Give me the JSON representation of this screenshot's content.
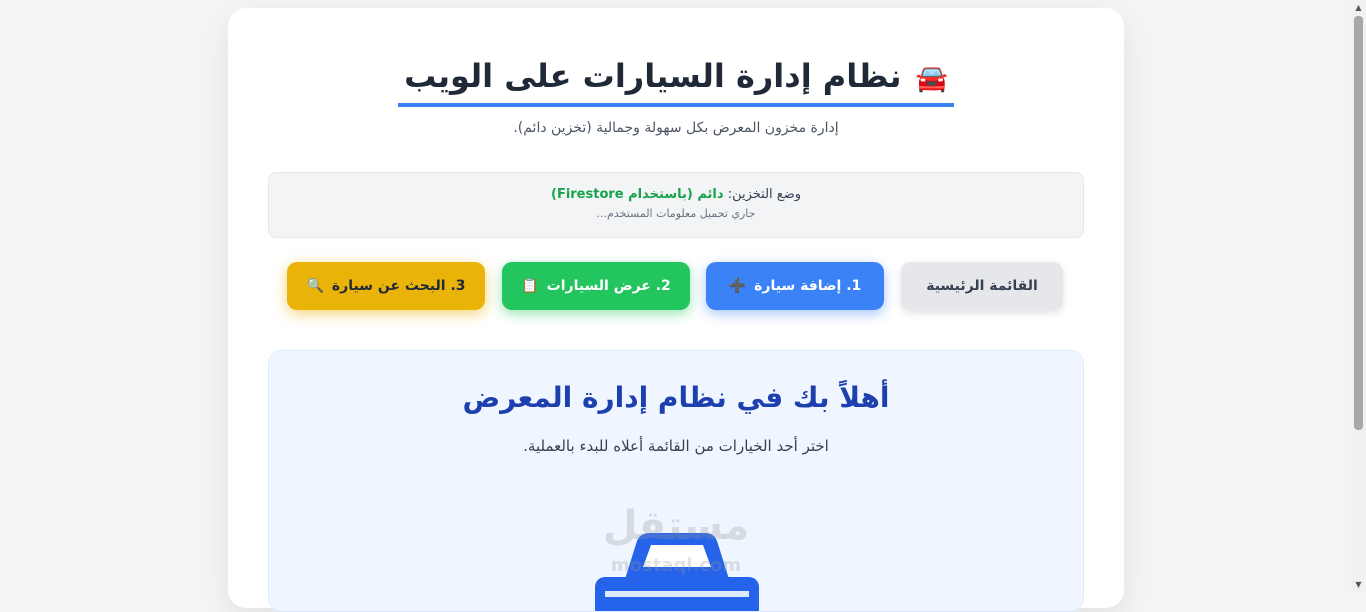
{
  "header": {
    "title": "نظام إدارة السيارات على الويب",
    "title_icon": "🚘",
    "subtitle": "إدارة مخزون المعرض بكل سهولة وجمالية (تخزين دائم)."
  },
  "storage": {
    "label": "وضع التخزين:",
    "mode": "دائم (باستخدام Firestore)",
    "status": "جاري تحميل معلومات المستخدم..."
  },
  "nav": {
    "main_label": "القائمة الرئيسية",
    "add_label": "1. إضافة سيارة",
    "add_icon": "➕",
    "view_label": "2. عرض السيارات",
    "view_icon": "📋",
    "search_label": "3. البحث عن سيارة",
    "search_icon": "🔍"
  },
  "welcome": {
    "heading": "أهلاً بك في نظام إدارة المعرض",
    "text": "اختر أحد الخيارات من القائمة أعلاه للبدء بالعملية."
  },
  "watermark": {
    "text": "مستقل",
    "url": "mostaql.com"
  },
  "colors": {
    "accent": "#3b82f6",
    "success": "#22c55e",
    "warning": "#eab308",
    "heading": "#1e40af"
  }
}
